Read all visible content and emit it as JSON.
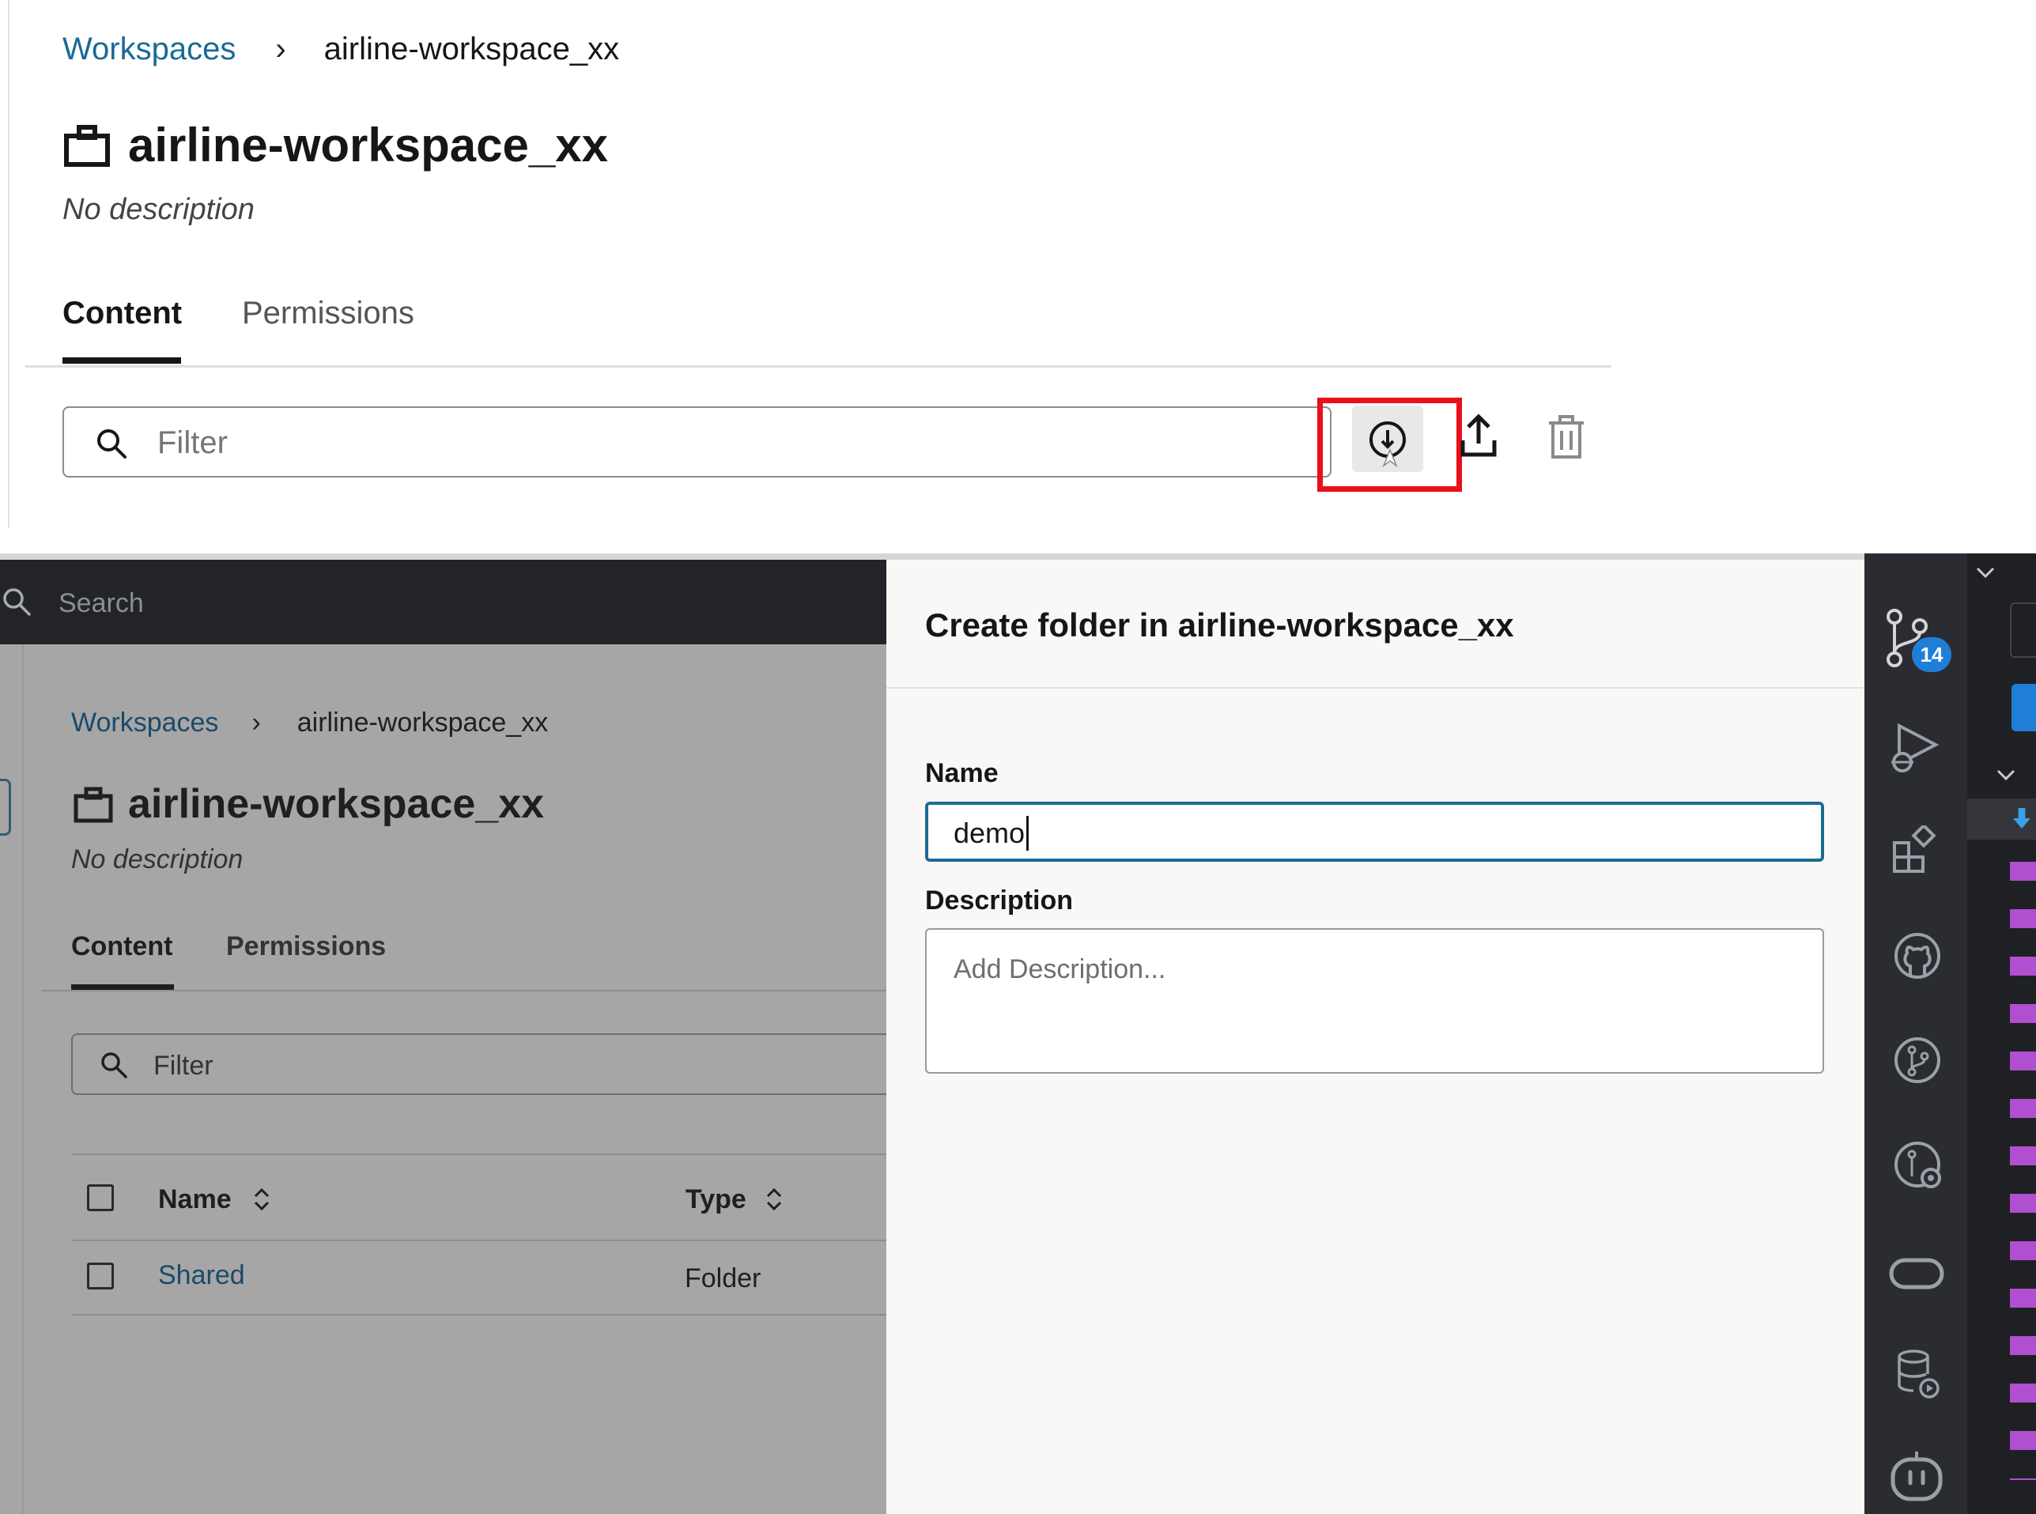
{
  "top": {
    "breadcrumb": {
      "root": "Workspaces",
      "separator": "›",
      "current": "airline-workspace_xx"
    },
    "title": "airline-workspace_xx",
    "description": "No description",
    "tabs": [
      {
        "label": "Content",
        "active": true
      },
      {
        "label": "Permissions",
        "active": false
      }
    ],
    "filter": {
      "placeholder": "Filter"
    },
    "toolbar_icons": [
      "create-folder-icon",
      "upload-icon",
      "trash-icon"
    ],
    "highlight_color": "#e8101a"
  },
  "bottom": {
    "search": {
      "placeholder": "Search"
    },
    "breadcrumb": {
      "root": "Workspaces",
      "separator": "›",
      "current": "airline-workspace_xx"
    },
    "title": "airline-workspace_xx",
    "description": "No description",
    "tabs": [
      {
        "label": "Content",
        "active": true
      },
      {
        "label": "Permissions",
        "active": false
      }
    ],
    "filter": {
      "placeholder": "Filter"
    },
    "table": {
      "columns": [
        {
          "label": "Name"
        },
        {
          "label": "Type"
        }
      ],
      "rows": [
        {
          "name": "Shared",
          "type": "Folder"
        }
      ]
    },
    "modal": {
      "title": "Create folder in airline-workspace_xx",
      "name_label": "Name",
      "name_value": "demo",
      "description_label": "Description",
      "description_placeholder": "Add Description..."
    },
    "activity_bar": {
      "icons": [
        "source-control-icon",
        "run-debug-icon",
        "extensions-icon",
        "github-icon",
        "git-branch-icon",
        "git-graph-icon",
        "remote-icon",
        "database-icon",
        "copilot-icon"
      ],
      "source_control_badge": "14"
    },
    "accent_color": "#1c6b92"
  }
}
